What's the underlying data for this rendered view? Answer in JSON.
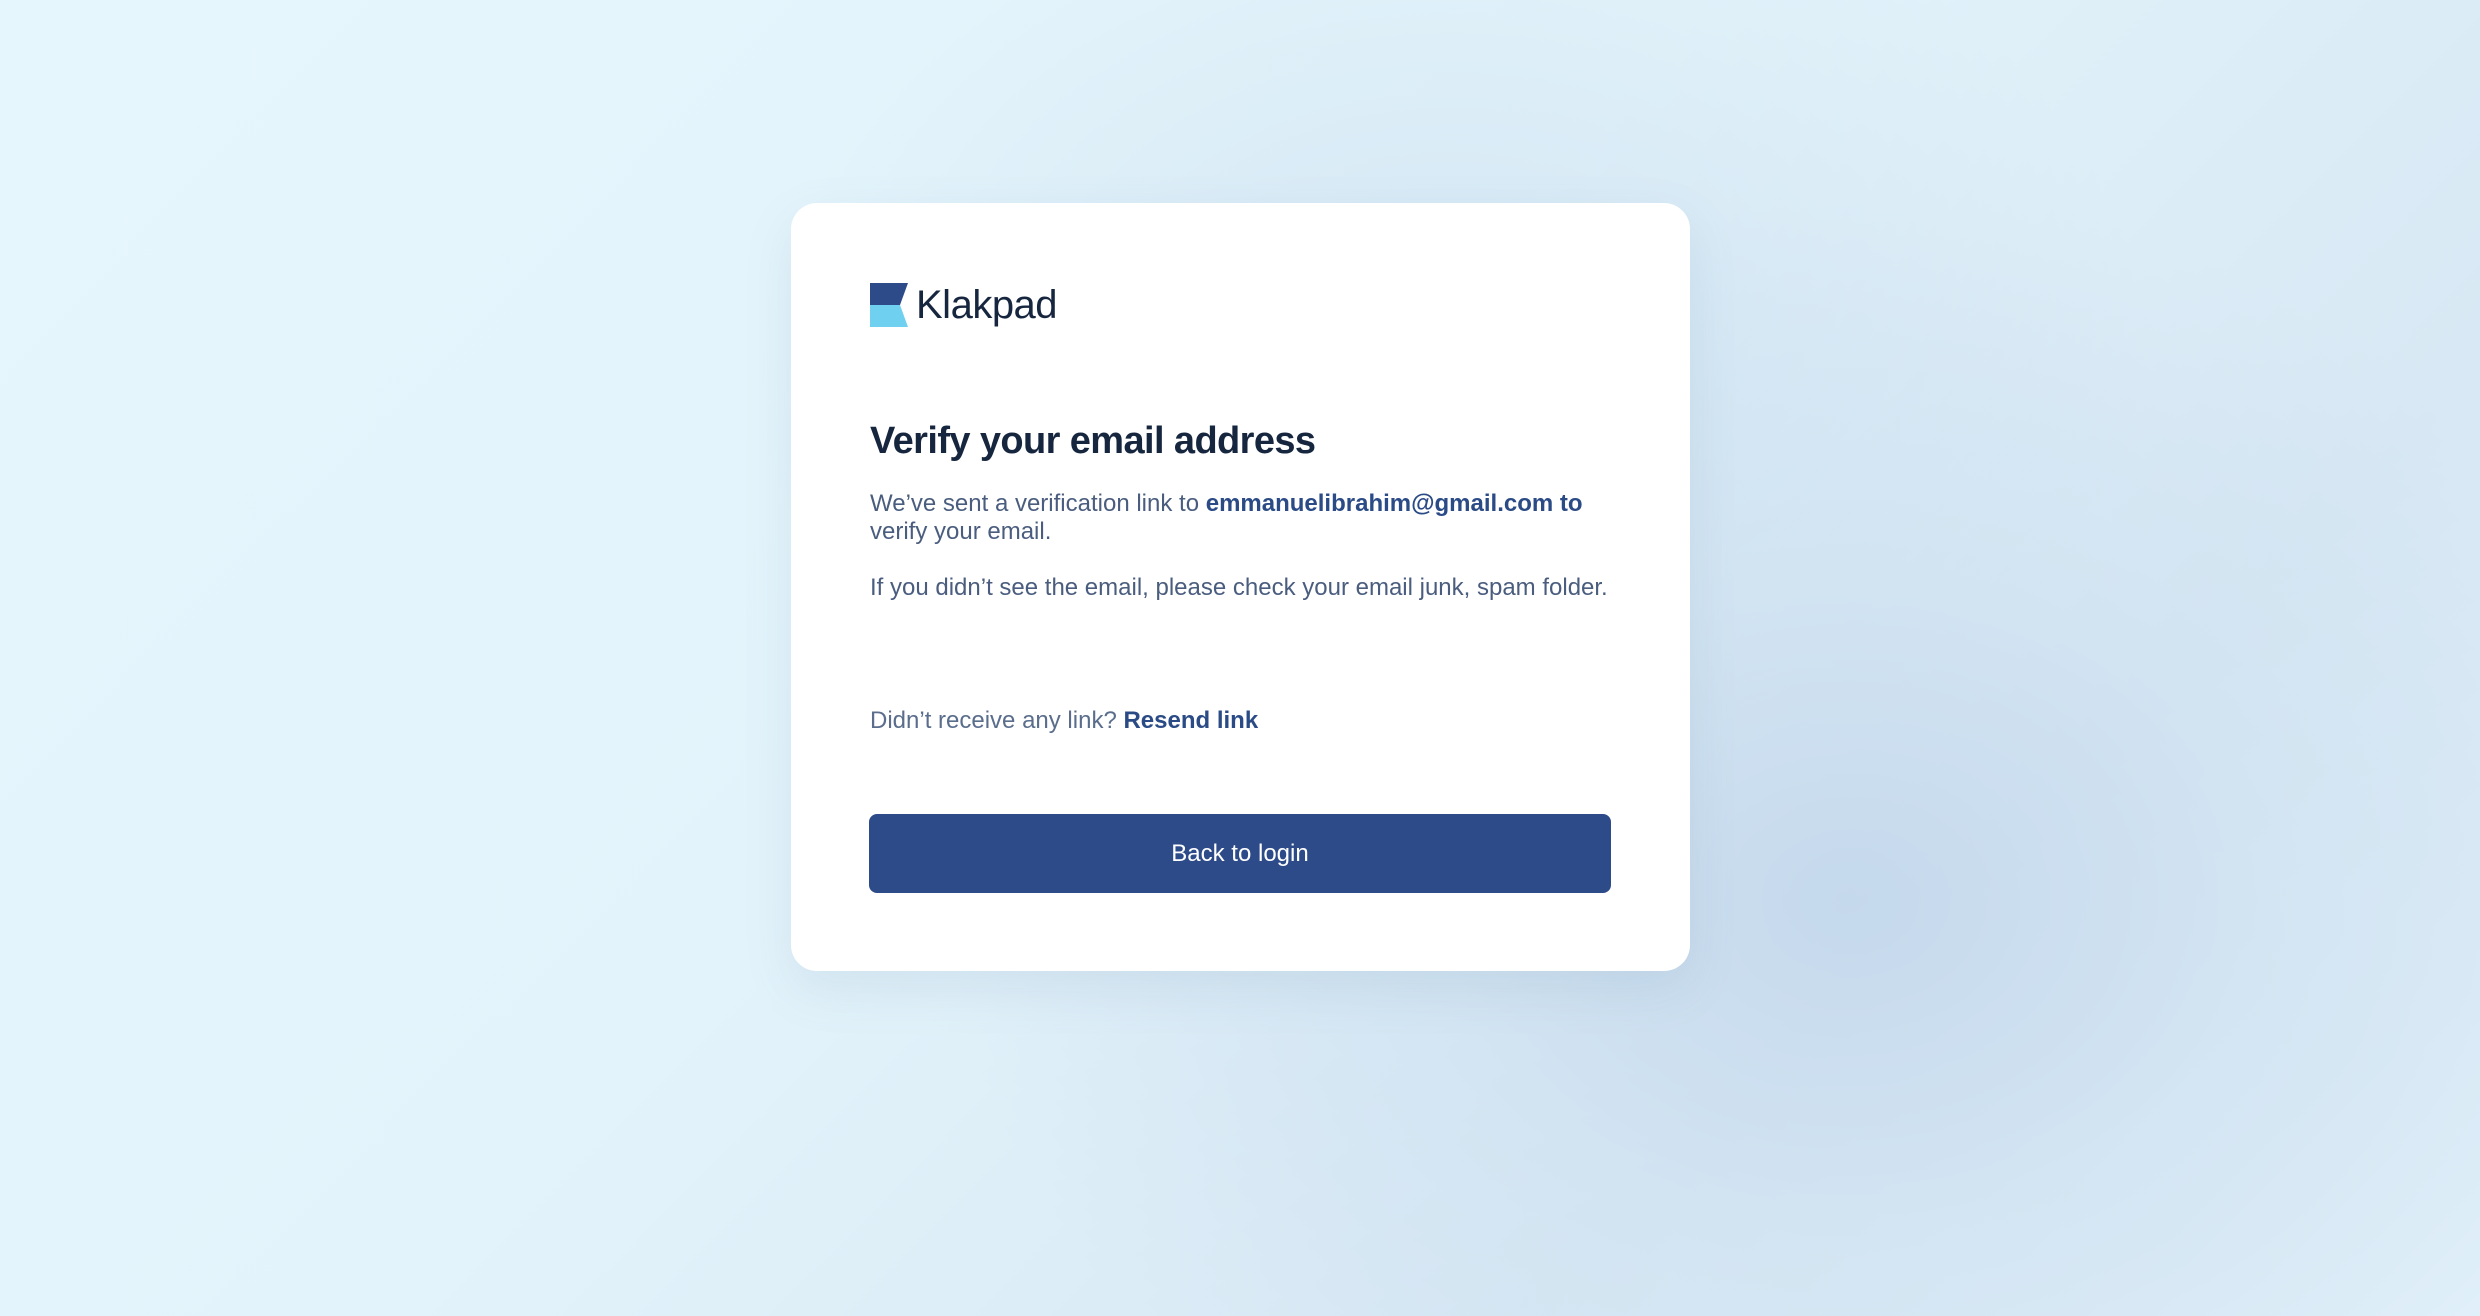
{
  "brand": {
    "name": "Klakpad",
    "logo_icon": "klakpad-logo-icon",
    "colors": {
      "dark": "#2e4b89",
      "light": "#6fd0f0",
      "text": "#17263f"
    }
  },
  "card": {
    "title": "Verify your email address",
    "message": {
      "prefix": "We’ve sent a verification link to ",
      "email": "emmanuelibrahim@gmail.com to",
      "suffix": " verify your email."
    },
    "hint": "If you didn’t see the email, please check your email junk, spam folder.",
    "resend": {
      "prompt": "Didn’t receive any link?",
      "link_label": "Resend link"
    },
    "back_button_label": "Back to login"
  },
  "colors": {
    "button": "#2e4b89",
    "link": "#2b4b86",
    "body_text": "#4a5d7e"
  }
}
